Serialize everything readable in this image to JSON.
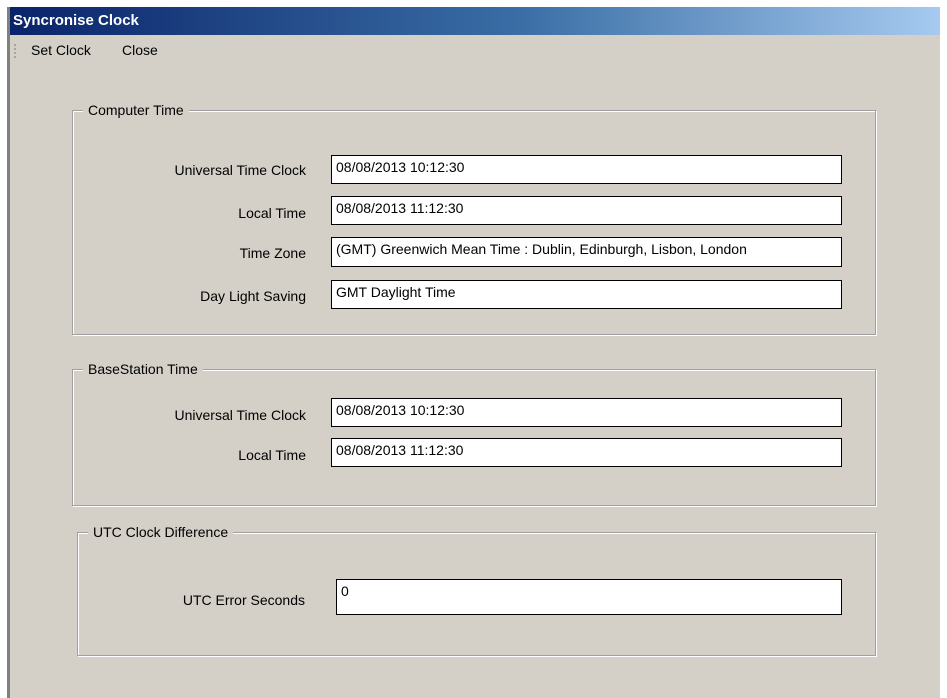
{
  "window": {
    "title": "Syncronise Clock"
  },
  "menu": {
    "set_clock": "Set Clock",
    "close": "Close"
  },
  "computer_time": {
    "legend": "Computer Time",
    "utc_label": "Universal Time Clock",
    "utc_value": "08/08/2013 10:12:30",
    "local_label": "Local Time",
    "local_value": "08/08/2013 11:12:30",
    "timezone_label": "Time Zone",
    "timezone_value": "(GMT) Greenwich Mean Time : Dublin, Edinburgh, Lisbon, London",
    "dst_label": "Day Light Saving",
    "dst_value": "GMT Daylight Time"
  },
  "basestation_time": {
    "legend": "BaseStation Time",
    "utc_label": "Universal Time Clock",
    "utc_value": "08/08/2013 10:12:30",
    "local_label": "Local Time",
    "local_value": "08/08/2013 11:12:30"
  },
  "utc_difference": {
    "legend": "UTC Clock Difference",
    "error_label": "UTC Error Seconds",
    "error_value": "0"
  }
}
